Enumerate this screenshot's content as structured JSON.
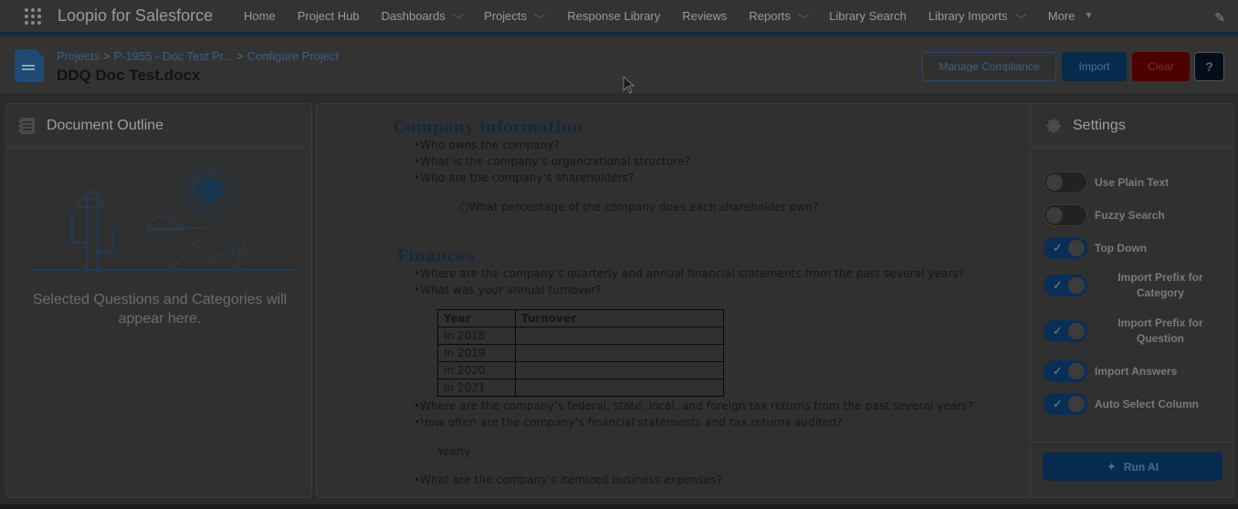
{
  "app": {
    "name": "Loopio for Salesforce"
  },
  "nav": {
    "items": [
      {
        "label": "Home",
        "dropdown": false
      },
      {
        "label": "Project Hub",
        "dropdown": false
      },
      {
        "label": "Dashboards",
        "dropdown": true
      },
      {
        "label": "Projects",
        "dropdown": true
      },
      {
        "label": "Response Library",
        "dropdown": false
      },
      {
        "label": "Reviews",
        "dropdown": false
      },
      {
        "label": "Reports",
        "dropdown": true
      },
      {
        "label": "Library Search",
        "dropdown": false
      },
      {
        "label": "Library Imports",
        "dropdown": true
      },
      {
        "label": "More",
        "dropdown": true
      }
    ]
  },
  "header": {
    "breadcrumbs": [
      "Projects",
      "P-1955 - Doc Test Pr...",
      "Configure Project"
    ],
    "title": "DDQ Doc Test.docx",
    "buttons": {
      "manage_compliance": "Manage Compliance",
      "import": "Import",
      "clear": "Clear",
      "help": "?"
    }
  },
  "outline": {
    "title": "Document Outline",
    "empty_message": "Selected Questions and Categories will appear here."
  },
  "document": {
    "heading1": "Company information",
    "q1": "•Who owns the company?",
    "q2": "•What is the company’s organizational structure?",
    "q3": "•Who are the company’s shareholders?",
    "q3a": "○What percentage of the company does each shareholder own?",
    "heading2": "Finances",
    "q4": "•Where are the company’s quarterly and annual financial statements from the past several years?",
    "q5": "•What was your annual turnover?",
    "table": {
      "headers": [
        "Year",
        "Turnover"
      ],
      "rows": [
        [
          "In 2018",
          ""
        ],
        [
          "In 2019",
          ""
        ],
        [
          "In 2020",
          ""
        ],
        [
          "In 2021",
          ""
        ]
      ]
    },
    "q6": "•Where are the company’s federal, state, local, and foreign tax returns from the past several years?",
    "q7": "•How often are the company’s financial statements and tax returns audited?",
    "a7": "Yearly",
    "q8": "•What are the company’s itemized business expenses?"
  },
  "settings": {
    "title": "Settings",
    "options": [
      {
        "label": "Use Plain Text",
        "on": false
      },
      {
        "label": "Fuzzy Search",
        "on": false
      },
      {
        "label": "Top Down",
        "on": true
      },
      {
        "label": "Import Prefix for Category",
        "on": true
      },
      {
        "label": "Import Prefix for Question",
        "on": true
      },
      {
        "label": "Import Answers",
        "on": true
      },
      {
        "label": "Auto Select Column",
        "on": true
      }
    ],
    "run_ai": "Run AI"
  },
  "colors": {
    "brand": "#0176d3",
    "danger": "#ba0517",
    "overlay": "dimmed"
  }
}
